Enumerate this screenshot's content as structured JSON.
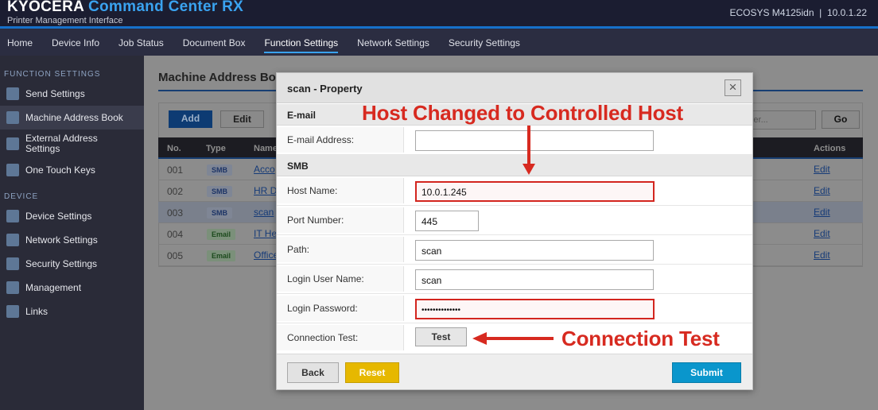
{
  "header": {
    "brand_main": "KYOCERA",
    "brand_accent": "Command Center RX",
    "subtitle": "Printer Management Interface",
    "device": "ECOSYS M4125idn  |  10.0.1.22"
  },
  "nav": [
    "Home",
    "Device Info",
    "Job Status",
    "Document Box",
    "Function Settings",
    "Network Settings",
    "Security Settings"
  ],
  "nav_active": "Function Settings",
  "sidebar": {
    "section1": "FUNCTION SETTINGS",
    "items1": [
      "Send Settings",
      "Machine Address Book",
      "External Address Settings",
      "One Touch Keys"
    ],
    "section2": "DEVICE",
    "items2": [
      "Device Settings",
      "Network Settings",
      "Security Settings",
      "Management",
      "Links"
    ]
  },
  "main": {
    "title": "Machine Address Bo",
    "add": "Add",
    "edit": "Edit",
    "search_placeholder": "umber...",
    "go": "Go",
    "columns": {
      "no": "No.",
      "type": "Type",
      "name": "Name",
      "actions": "Actions"
    },
    "rows": [
      {
        "no": "001",
        "type": "SMB",
        "name": "Acco",
        "action": "Edit"
      },
      {
        "no": "002",
        "type": "SMB",
        "name": "HR D",
        "action": "Edit"
      },
      {
        "no": "003",
        "type": "SMB",
        "name": "scan",
        "action": "Edit"
      },
      {
        "no": "004",
        "type": "Email",
        "name": "IT He",
        "action": "Edit"
      },
      {
        "no": "005",
        "type": "Email",
        "name": "Office",
        "action": "Edit"
      }
    ]
  },
  "modal": {
    "title": "scan - Property",
    "close": "×",
    "email_group": "E-mail",
    "email_label": "E-mail Address:",
    "email_value": "",
    "smb_group": "SMB",
    "host_label": "Host Name:",
    "host_value": "10.0.1.245",
    "port_label": "Port Number:",
    "port_value": "445",
    "path_label": "Path:",
    "path_value": "scan",
    "user_label": "Login User Name:",
    "user_value": "scan",
    "pass_label": "Login Password:",
    "pass_value": "••••••••••••••",
    "test_label": "Connection Test:",
    "test_button": "Test",
    "back": "Back",
    "reset": "Reset",
    "submit": "Submit"
  },
  "annotations": {
    "host": "Host Changed to Controlled Host",
    "test": "Connection Test",
    "color": "#d72a20"
  }
}
